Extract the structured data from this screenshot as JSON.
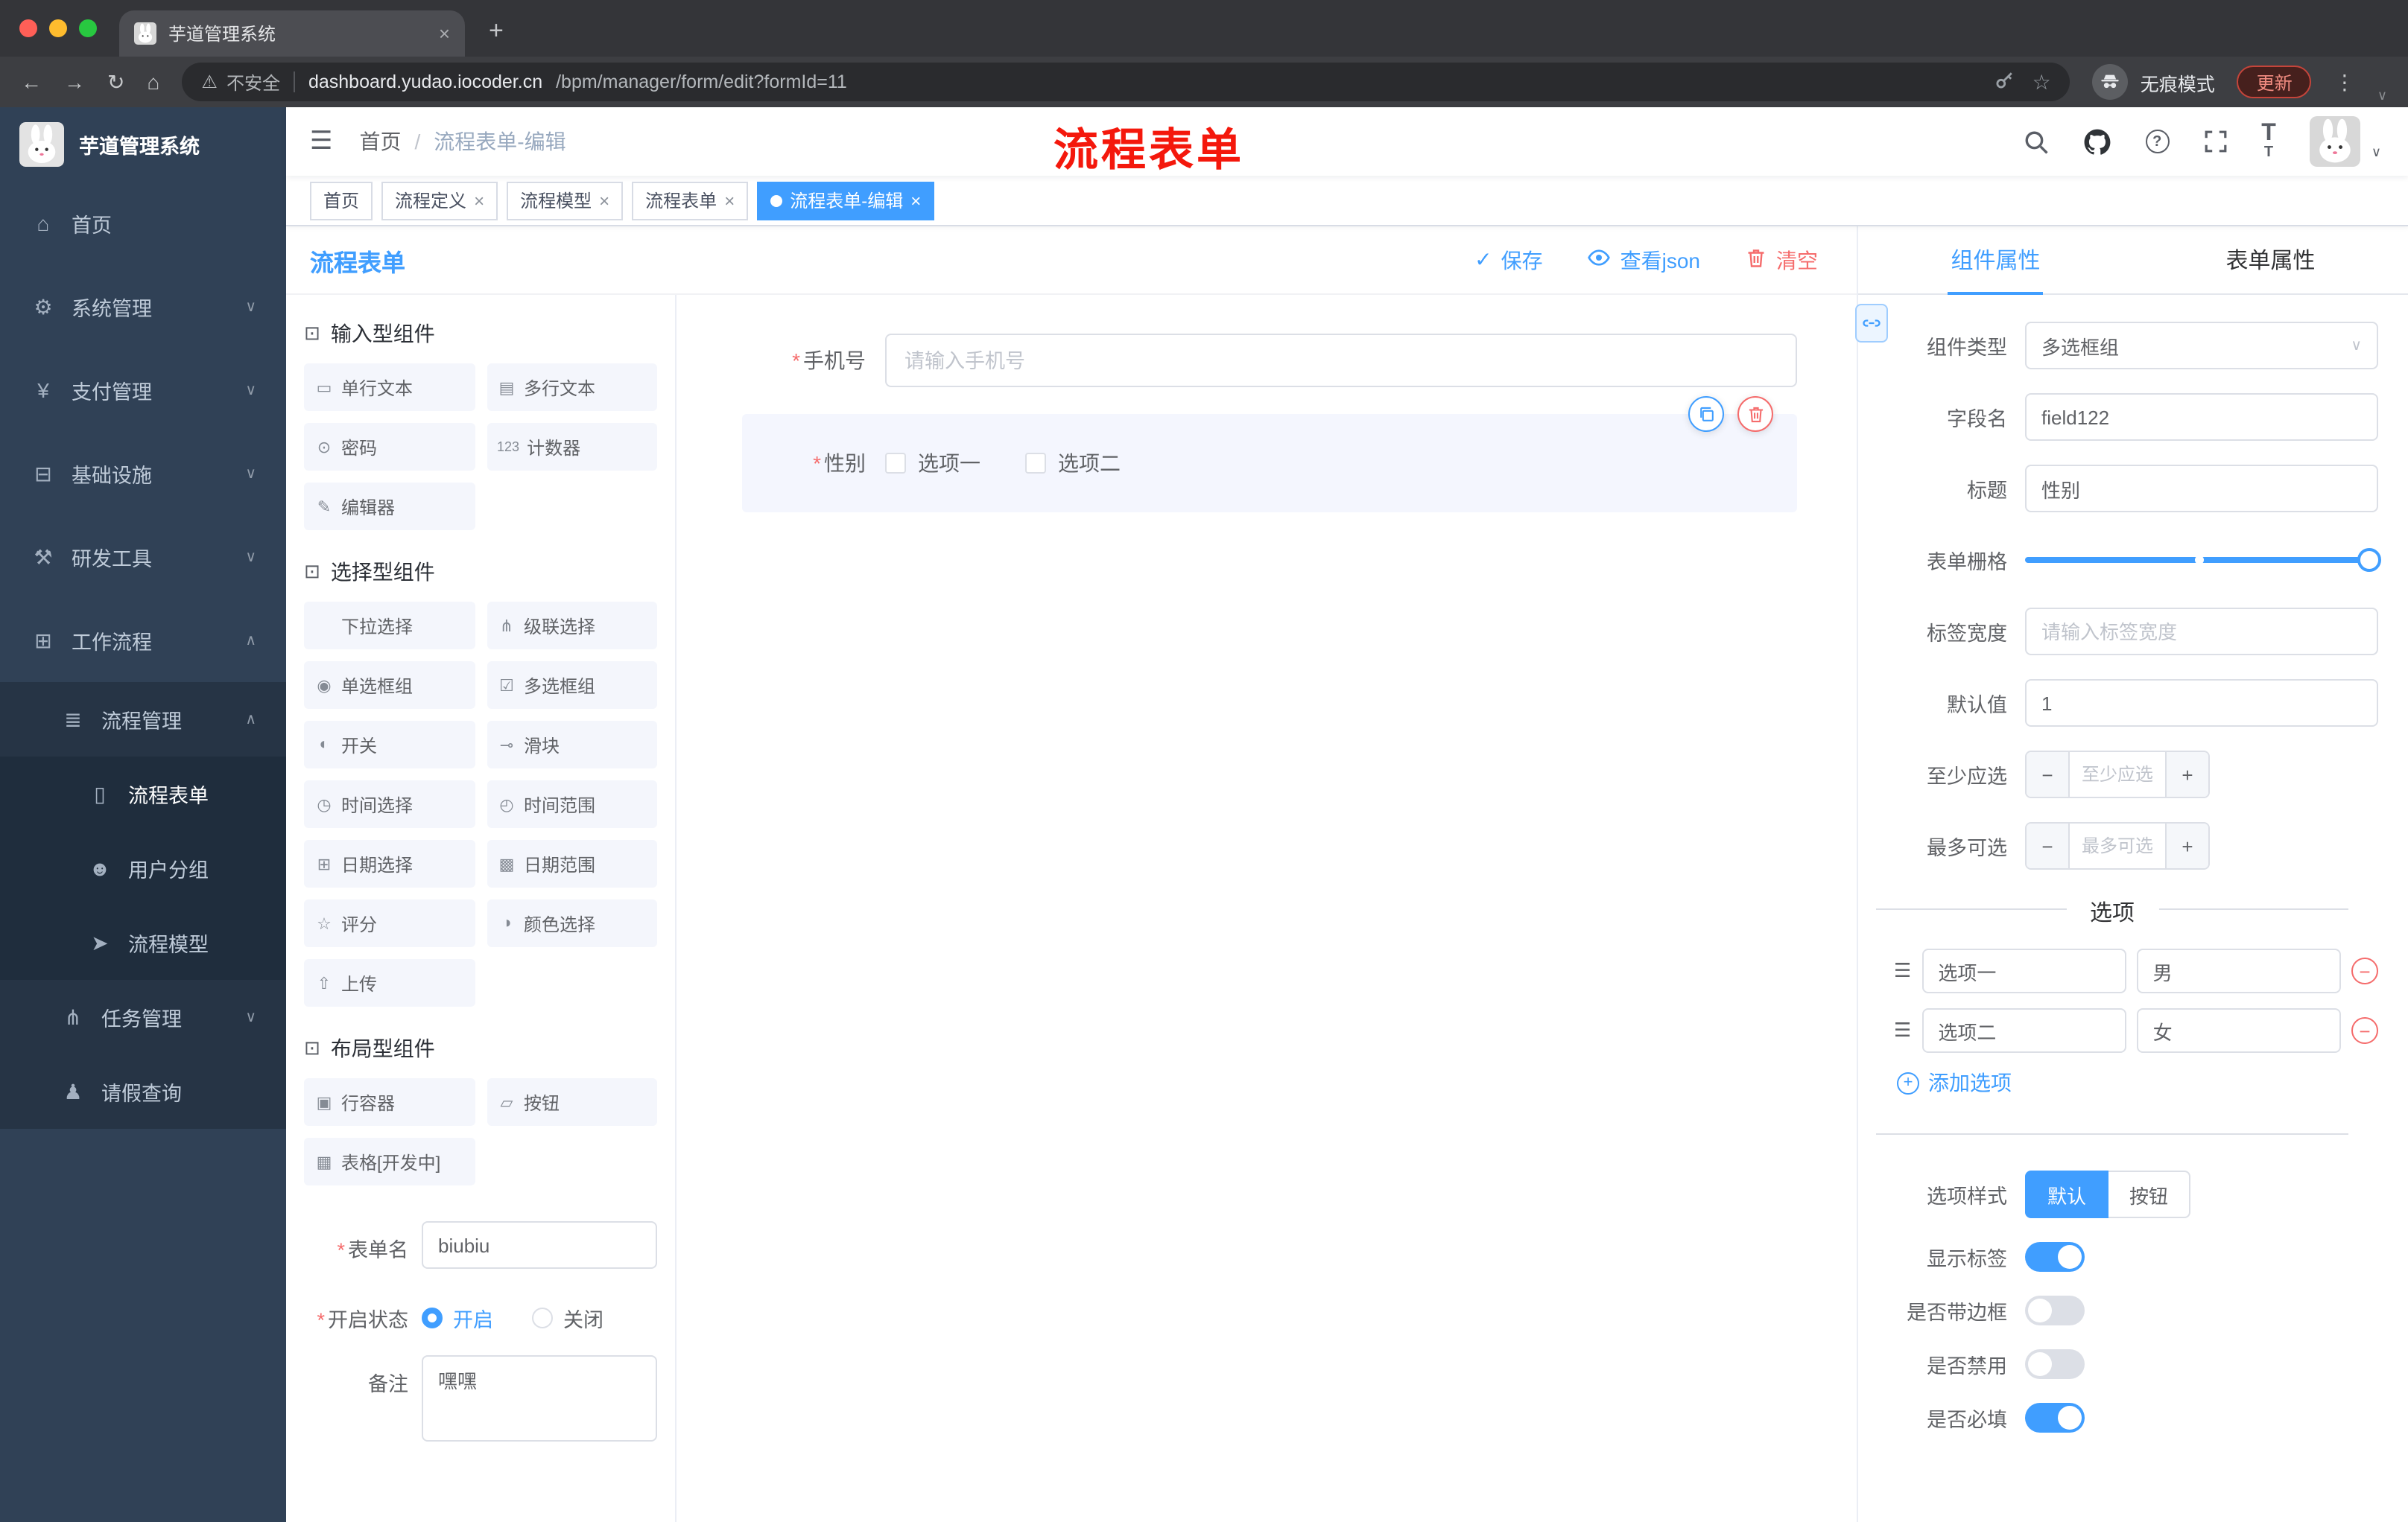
{
  "misc": {
    "required": "*"
  },
  "icons": {
    "back": "←",
    "forward": "→",
    "reload": "↻",
    "navhome": "⌂",
    "warning": "⚠",
    "star": "☆",
    "dots": "⋮",
    "newtab": "+",
    "close": "×",
    "chev_down": "∨",
    "chev_up": "∧",
    "hamburger": "☰",
    "check": "✓",
    "qmark": "?",
    "fontT_big": "T",
    "fontT_small": "T",
    "menu_home": "⌂",
    "menu_system": "⚙",
    "menu_pay": "¥",
    "menu_infra": "⊟",
    "menu_dev": "⚒",
    "menu_flow": "⊞",
    "menu_list": "≣",
    "menu_doc": "▯",
    "menu_users": "☻",
    "menu_send": "➤",
    "menu_tree": "⋔",
    "menu_person": "♟",
    "cube": "⊡",
    "drag": "☰",
    "minus": "−",
    "plus": "+"
  },
  "browser": {
    "tab_title": "芋道管理系统",
    "security": "不安全",
    "url_host": "dashboard.yudao.iocoder.cn",
    "url_path": "/bpm/manager/form/edit?formId=11",
    "incognito": "无痕模式",
    "update": "更新"
  },
  "header": {
    "breadcrumb_home": "首页",
    "breadcrumb_sep": "/",
    "breadcrumb_current": "流程表单-编辑",
    "annotation": "流程表单"
  },
  "tags": [
    {
      "label": "首页"
    },
    {
      "label": "流程定义"
    },
    {
      "label": "流程模型"
    },
    {
      "label": "流程表单"
    },
    {
      "label": "流程表单-编辑"
    }
  ],
  "sidebar": {
    "title": "芋道管理系统",
    "items": [
      {
        "label": "首页"
      },
      {
        "label": "系统管理"
      },
      {
        "label": "支付管理"
      },
      {
        "label": "基础设施"
      },
      {
        "label": "研发工具"
      },
      {
        "label": "工作流程"
      },
      {
        "label": "流程管理"
      },
      {
        "label": "流程表单"
      },
      {
        "label": "用户分组"
      },
      {
        "label": "流程模型"
      },
      {
        "label": "任务管理"
      },
      {
        "label": "请假查询"
      }
    ]
  },
  "designer": {
    "title": "流程表单",
    "save": "保存",
    "view_json": "查看json",
    "clear": "清空"
  },
  "palette": {
    "groups": [
      {
        "title": "输入型组件",
        "items": [
          {
            "label": "单行文本",
            "glyph": "▭"
          },
          {
            "label": "多行文本",
            "glyph": "▤"
          },
          {
            "label": "密码",
            "glyph": "⊙"
          },
          {
            "label": "计数器",
            "glyph": "123"
          },
          {
            "label": "编辑器",
            "glyph": "✎"
          }
        ]
      },
      {
        "title": "选择型组件",
        "items": [
          {
            "label": "下拉选择",
            "glyph": "◎"
          },
          {
            "label": "级联选择",
            "glyph": "⋔"
          },
          {
            "label": "单选框组",
            "glyph": "◉"
          },
          {
            "label": "多选框组",
            "glyph": "☑"
          },
          {
            "label": "开关",
            "glyph": "◐"
          },
          {
            "label": "滑块",
            "glyph": "⊸"
          },
          {
            "label": "时间选择",
            "glyph": "◷"
          },
          {
            "label": "时间范围",
            "glyph": "◴"
          },
          {
            "label": "日期选择",
            "glyph": "⊞"
          },
          {
            "label": "日期范围",
            "glyph": "▩"
          },
          {
            "label": "评分",
            "glyph": "☆"
          },
          {
            "label": "颜色选择",
            "glyph": "◑"
          },
          {
            "label": "上传",
            "glyph": "⇧"
          }
        ]
      },
      {
        "title": "布局型组件",
        "items": [
          {
            "label": "行容器",
            "glyph": "▣"
          },
          {
            "label": "按钮",
            "glyph": "▱"
          },
          {
            "label": "表格[开发中]",
            "glyph": "▦"
          }
        ]
      }
    ],
    "meta": {
      "form_name_label": "表单名",
      "form_name_value": "biubiu",
      "status_label": "开启状态",
      "status_on": "开启",
      "status_off": "关闭",
      "remark_label": "备注",
      "remark_value": "嘿嘿"
    }
  },
  "canvas": {
    "phone_label": "手机号",
    "phone_placeholder": "请输入手机号",
    "gender_label": "性别",
    "gender_option1": "选项一",
    "gender_option2": "选项二"
  },
  "panel": {
    "tab_component": "组件属性",
    "tab_form": "表单属性",
    "component_type_label": "组件类型",
    "component_type_value": "多选框组",
    "field_name_label": "字段名",
    "field_name_value": "field122",
    "title_label": "标题",
    "title_value": "性别",
    "grid_label": "表单栅格",
    "label_width_label": "标签宽度",
    "label_width_placeholder": "请输入标签宽度",
    "default_label": "默认值",
    "default_value": "1",
    "min_label": "至少应选",
    "min_placeholder": "至少应选",
    "max_label": "最多可选",
    "max_placeholder": "最多可选",
    "options_divider": "选项",
    "options": [
      {
        "label": "选项一",
        "value": "男"
      },
      {
        "label": "选项二",
        "value": "女"
      }
    ],
    "add_option": "添加选项",
    "style_label": "选项样式",
    "style_default": "默认",
    "style_button": "按钮",
    "show_label": "显示标签",
    "border_label": "是否带边框",
    "disabled_label": "是否禁用",
    "required_label": "是否必填"
  }
}
